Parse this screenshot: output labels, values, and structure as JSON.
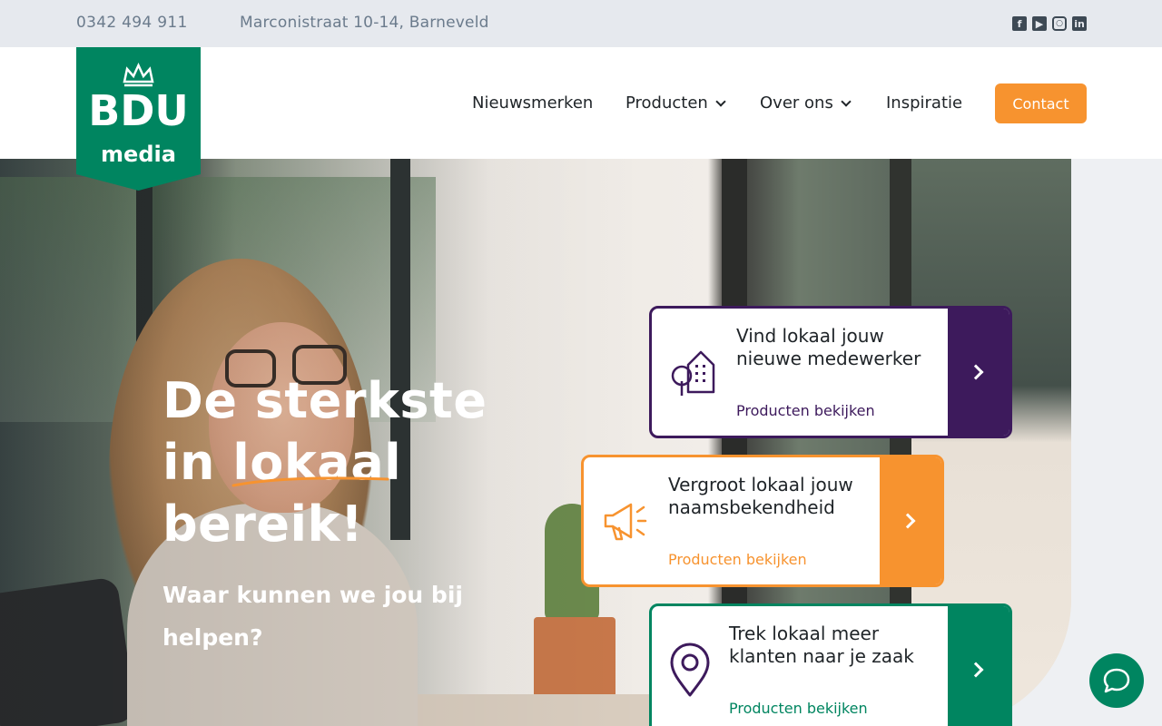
{
  "topbar": {
    "phone": "0342 494 911",
    "address": "Marconistraat 10-14, Barneveld",
    "social": [
      "facebook-icon",
      "youtube-icon",
      "instagram-icon",
      "linkedin-icon"
    ]
  },
  "logo": {
    "top": "BDU",
    "bottom": "media"
  },
  "nav": {
    "items": [
      {
        "label": "Nieuwsmerken"
      },
      {
        "label": "Producten"
      },
      {
        "label": "Over ons"
      },
      {
        "label": "Inspiratie"
      }
    ],
    "contact": "Contact"
  },
  "hero": {
    "headline_line1": "De sterkste",
    "headline_line2": "in lokaal",
    "headline_line3": "bereik!",
    "subline": "Waar kunnen we jou bij helpen?"
  },
  "cards": [
    {
      "title": "Vind lokaal jouw nieuwe medewerker",
      "link": "Producten bekijken",
      "icon": "city-tree-icon",
      "color": "#3d1a5c"
    },
    {
      "title": "Vergroot lokaal jouw naamsbekendheid",
      "link": "Producten bekijken",
      "icon": "megaphone-icon",
      "color": "#f7932f"
    },
    {
      "title": "Trek lokaal meer klanten naar je zaak",
      "link": "Producten bekijken",
      "icon": "map-pin-icon",
      "color": "#008560"
    }
  ],
  "colors": {
    "brand_green": "#008560",
    "accent_orange": "#f7932f",
    "purple": "#3d1a5c"
  }
}
